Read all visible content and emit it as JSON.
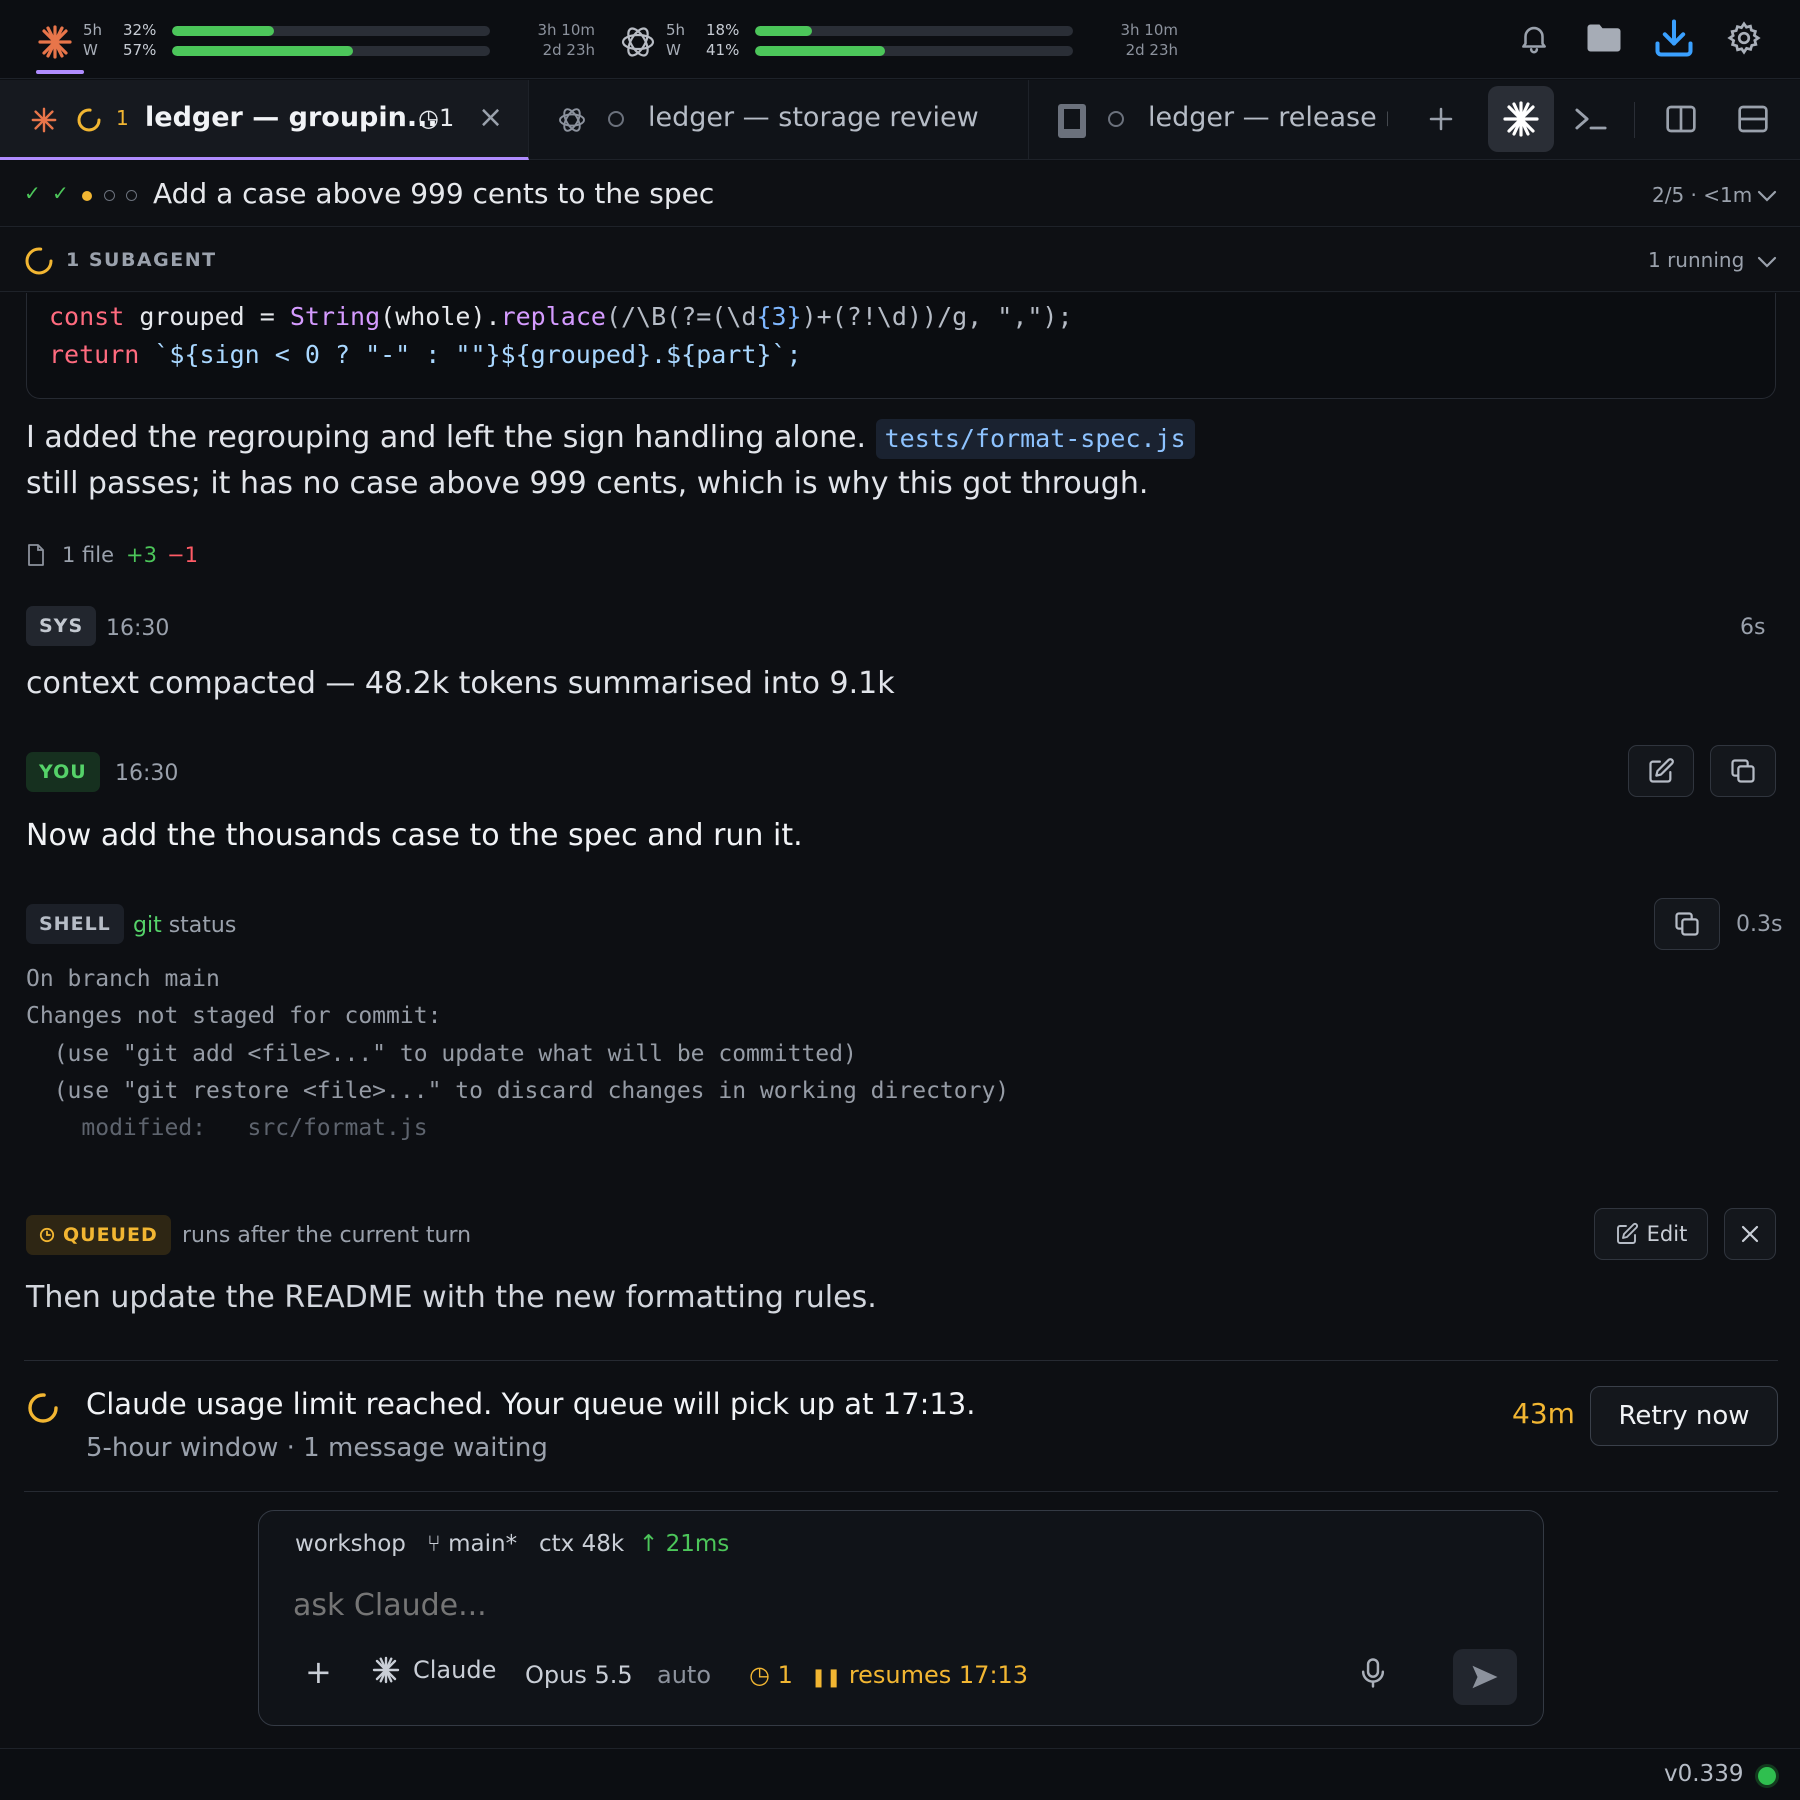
{
  "usage": [
    {
      "provider": "claude",
      "rows": [
        {
          "label": "5h",
          "pct": "32%",
          "fill": 0.32
        },
        {
          "label": "W",
          "pct": "57%",
          "fill": 0.57
        }
      ],
      "times": [
        "3h 10m",
        "2d 23h"
      ],
      "color": "#e8754a"
    },
    {
      "provider": "openai",
      "rows": [
        {
          "label": "5h",
          "pct": "18%",
          "fill": 0.18
        },
        {
          "label": "W",
          "pct": "41%",
          "fill": 0.41
        }
      ],
      "times": [
        "3h 10m",
        "2d 23h"
      ],
      "color": "#c8ccd3"
    }
  ],
  "tabs": [
    {
      "title": "ledger — groupin...",
      "count": "1",
      "queue_badge": "◷1",
      "close": "×"
    },
    {
      "title": "ledger — storage review"
    },
    {
      "title": "ledger — release nc"
    }
  ],
  "task": {
    "title": "Add a case above 999 cents to the spec",
    "progress": "2/5 · <1m"
  },
  "subagent": {
    "label": "1 SUBAGENT",
    "status": "1 running"
  },
  "code": {
    "line1": {
      "kw": "const",
      "a": " grouped = ",
      "fn1": "String",
      "b": "(whole).",
      "fn2": "replace",
      "c": "(/\\B(?=(\\d",
      "q": "{3}",
      "d": ")+(?!\\d))/g, \",\");"
    },
    "line2": {
      "kw": "return",
      "rest": " `${sign < 0 ? \"-\" : \"\"}${grouped}.${part}`;"
    }
  },
  "assistant_text": {
    "part1": "I added the regrouping and left the sign handling alone.",
    "code_ref": "tests/format-spec.js",
    "part2": "still passes; it has no case above 999 cents, which is why this got through."
  },
  "diffstat": {
    "files": "1 file",
    "added": "+3",
    "removed": "−1"
  },
  "sys": {
    "badge": "SYS",
    "time": "16:30",
    "duration": "6s",
    "text": "context compacted — 48.2k tokens summarised into 9.1k"
  },
  "you": {
    "badge": "YOU",
    "time": "16:30",
    "text": "Now add the thousands case to the spec and run it."
  },
  "shell": {
    "badge": "SHELL",
    "cmd": "git",
    "args": " status",
    "duration": "0.3s",
    "output": [
      "On branch main",
      "Changes not staged for commit:",
      "  (use \"git add <file>...\" to update what will be committed)",
      "  (use \"git restore <file>...\" to discard changes in working directory)",
      "    modified:   src/format.js"
    ]
  },
  "queued": {
    "badge": "QUEUED",
    "note": "runs after the current turn",
    "edit": "Edit",
    "text": "Then update the README with the new formatting rules."
  },
  "limit": {
    "title": "Claude usage limit reached. Your queue will pick up at 17:13.",
    "sub": "5-hour window · 1 message waiting",
    "countdown": "43m",
    "retry": "Retry now"
  },
  "composer": {
    "workspace": "workshop",
    "branch": "main*",
    "ctx": "ctx 48k",
    "latency": "↑ 21ms",
    "placeholder": "ask Claude...",
    "agent": "Claude",
    "model": "Opus 5.5",
    "mode": "auto",
    "queue": "1",
    "resumes": "resumes 17:13"
  },
  "version": "v0.339"
}
